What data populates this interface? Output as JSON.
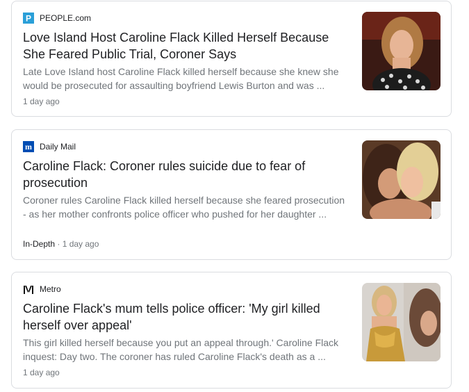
{
  "articles": [
    {
      "source": "PEOPLE.com",
      "favicon": "people-logo-icon",
      "title": "Love Island Host Caroline Flack Killed Herself Because She Feared Public Trial, Coroner Says",
      "snippet": "Late Love Island host Caroline Flack killed herself because she knew she would be prosecuted for assaulting boyfriend Lewis Burton and was ...",
      "tag": "",
      "time": "1 day ago"
    },
    {
      "source": "Daily Mail",
      "favicon": "daily-mail-logo-icon",
      "title": "Caroline Flack: Coroner rules suicide due to fear of prosecution",
      "snippet": "Coroner rules Caroline Flack killed herself because she feared prosecution - as her mother confronts police officer who pushed for her daughter ...",
      "tag": "In-Depth",
      "time": "· 1 day ago"
    },
    {
      "source": "Metro",
      "favicon": "metro-logo-icon",
      "title": "Caroline Flack's mum tells police officer: 'My girl killed herself over appeal'",
      "snippet": "This girl killed herself because you put an appeal through.' Caroline Flack inquest: Day two. The coroner has ruled Caroline Flack's death as a ...",
      "tag": "",
      "time": "1 day ago"
    }
  ],
  "colors": {
    "people_blue": "#2a9fd8",
    "dailymail_blue": "#004db3",
    "border": "#dadce0",
    "muted": "#70757a"
  }
}
